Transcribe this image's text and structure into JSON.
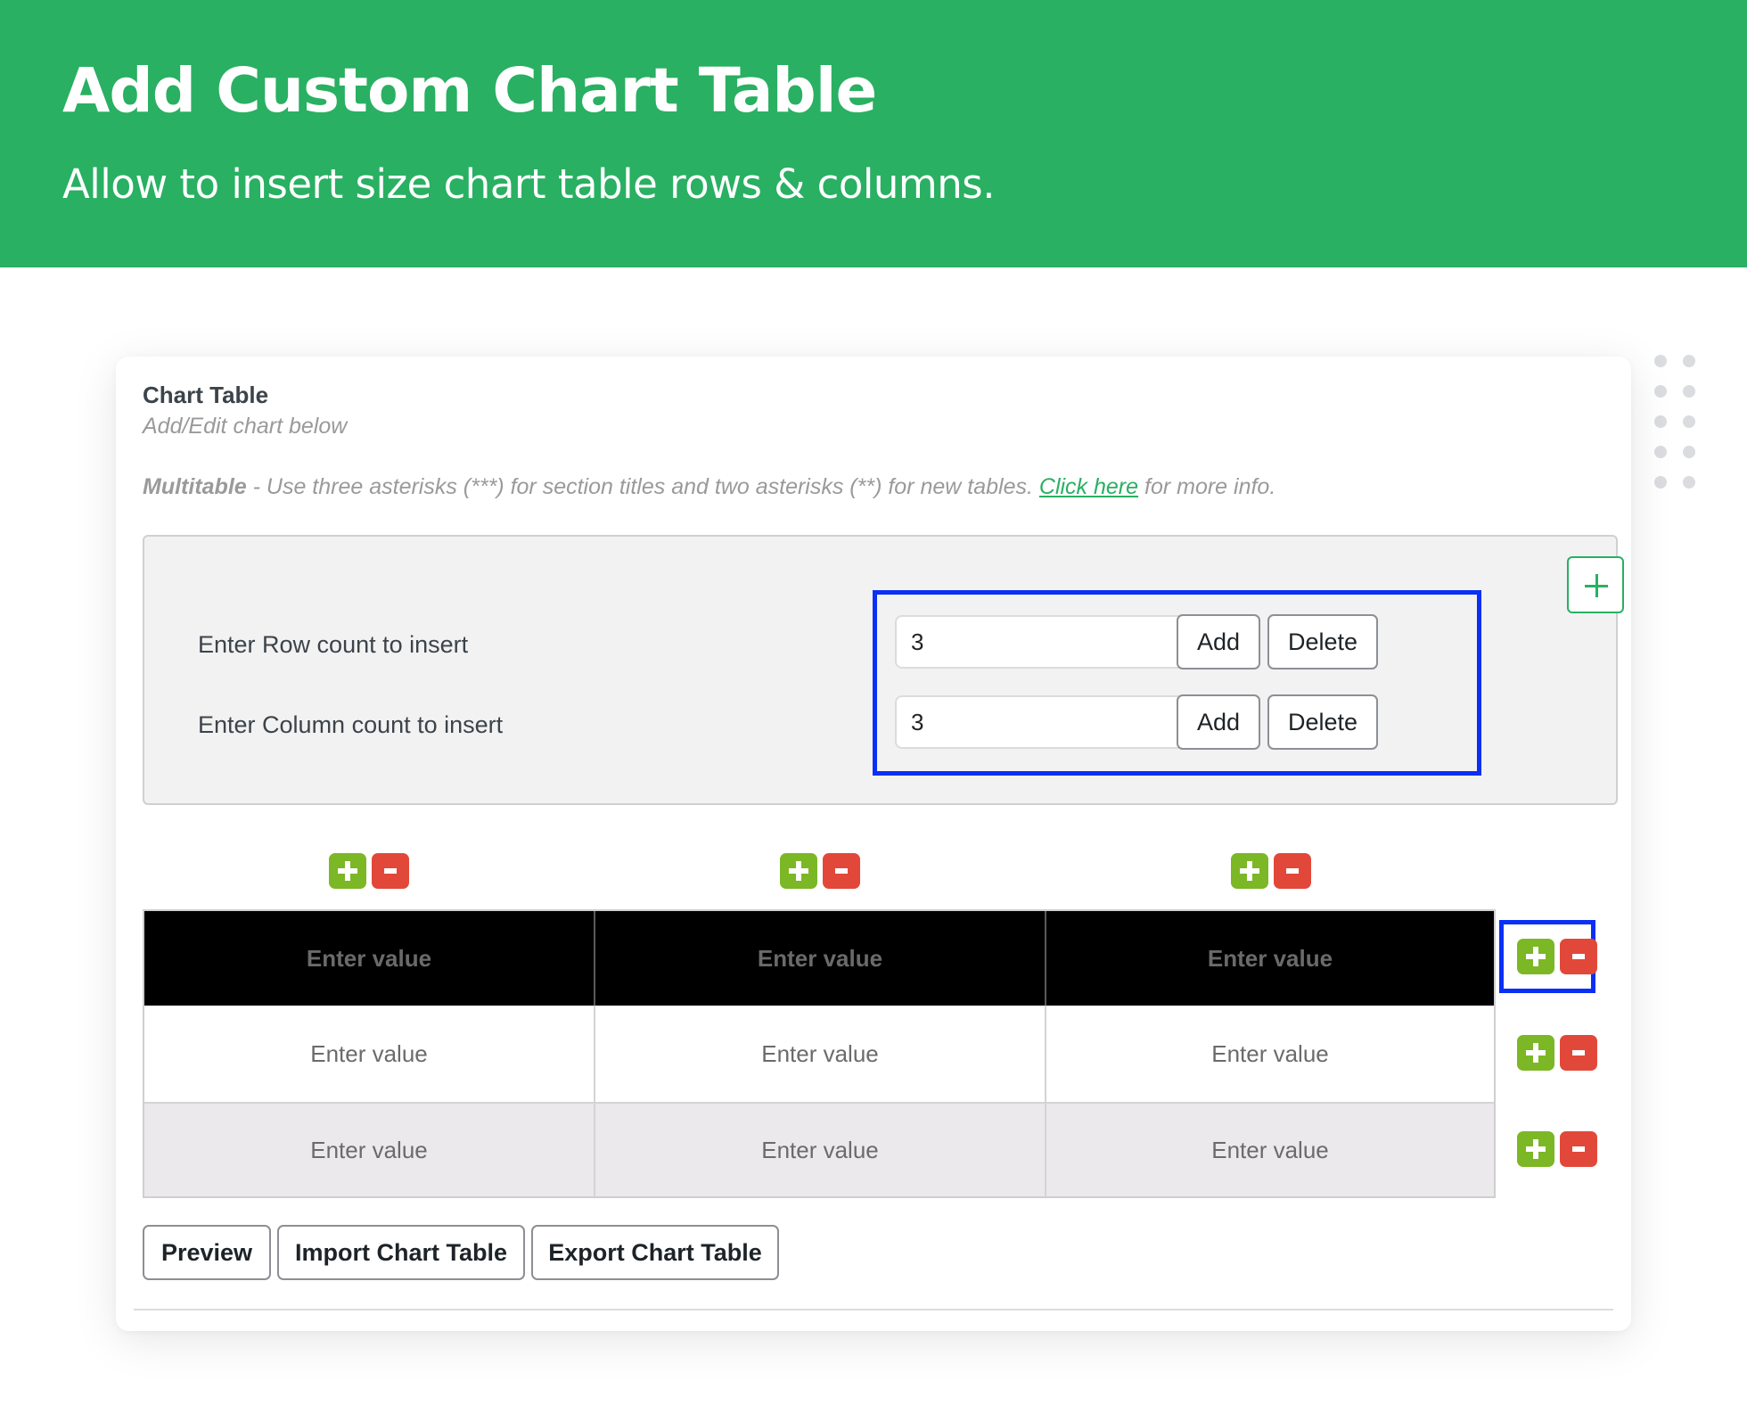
{
  "banner": {
    "title": "Add Custom Chart Table",
    "subtitle": "Allow to insert size chart table rows & columns."
  },
  "card": {
    "title": "Chart Table",
    "subtitle": "Add/Edit chart below",
    "note": {
      "bold": "Multitable",
      "text": " - Use three asterisks (***) for section titles and two asterisks (**) for new tables. ",
      "link": "Click here",
      "suffix": " for more info."
    }
  },
  "panel": {
    "row_label": "Enter Row count to insert",
    "row_value": "3",
    "col_label": "Enter Column count to insert",
    "col_value": "3",
    "add_label": "Add",
    "delete_label": "Delete"
  },
  "table": {
    "header": [
      "Enter value",
      "Enter value",
      "Enter value"
    ],
    "rows": [
      [
        "Enter value",
        "Enter value",
        "Enter value"
      ],
      [
        "Enter value",
        "Enter value",
        "Enter value"
      ]
    ]
  },
  "actions": {
    "preview": "Preview",
    "import": "Import Chart Table",
    "export": "Export Chart Table"
  },
  "colors": {
    "brand_green": "#29b062",
    "add_green": "#7cb726",
    "remove_red": "#e2483a",
    "highlight_blue": "#0a2ff5"
  }
}
